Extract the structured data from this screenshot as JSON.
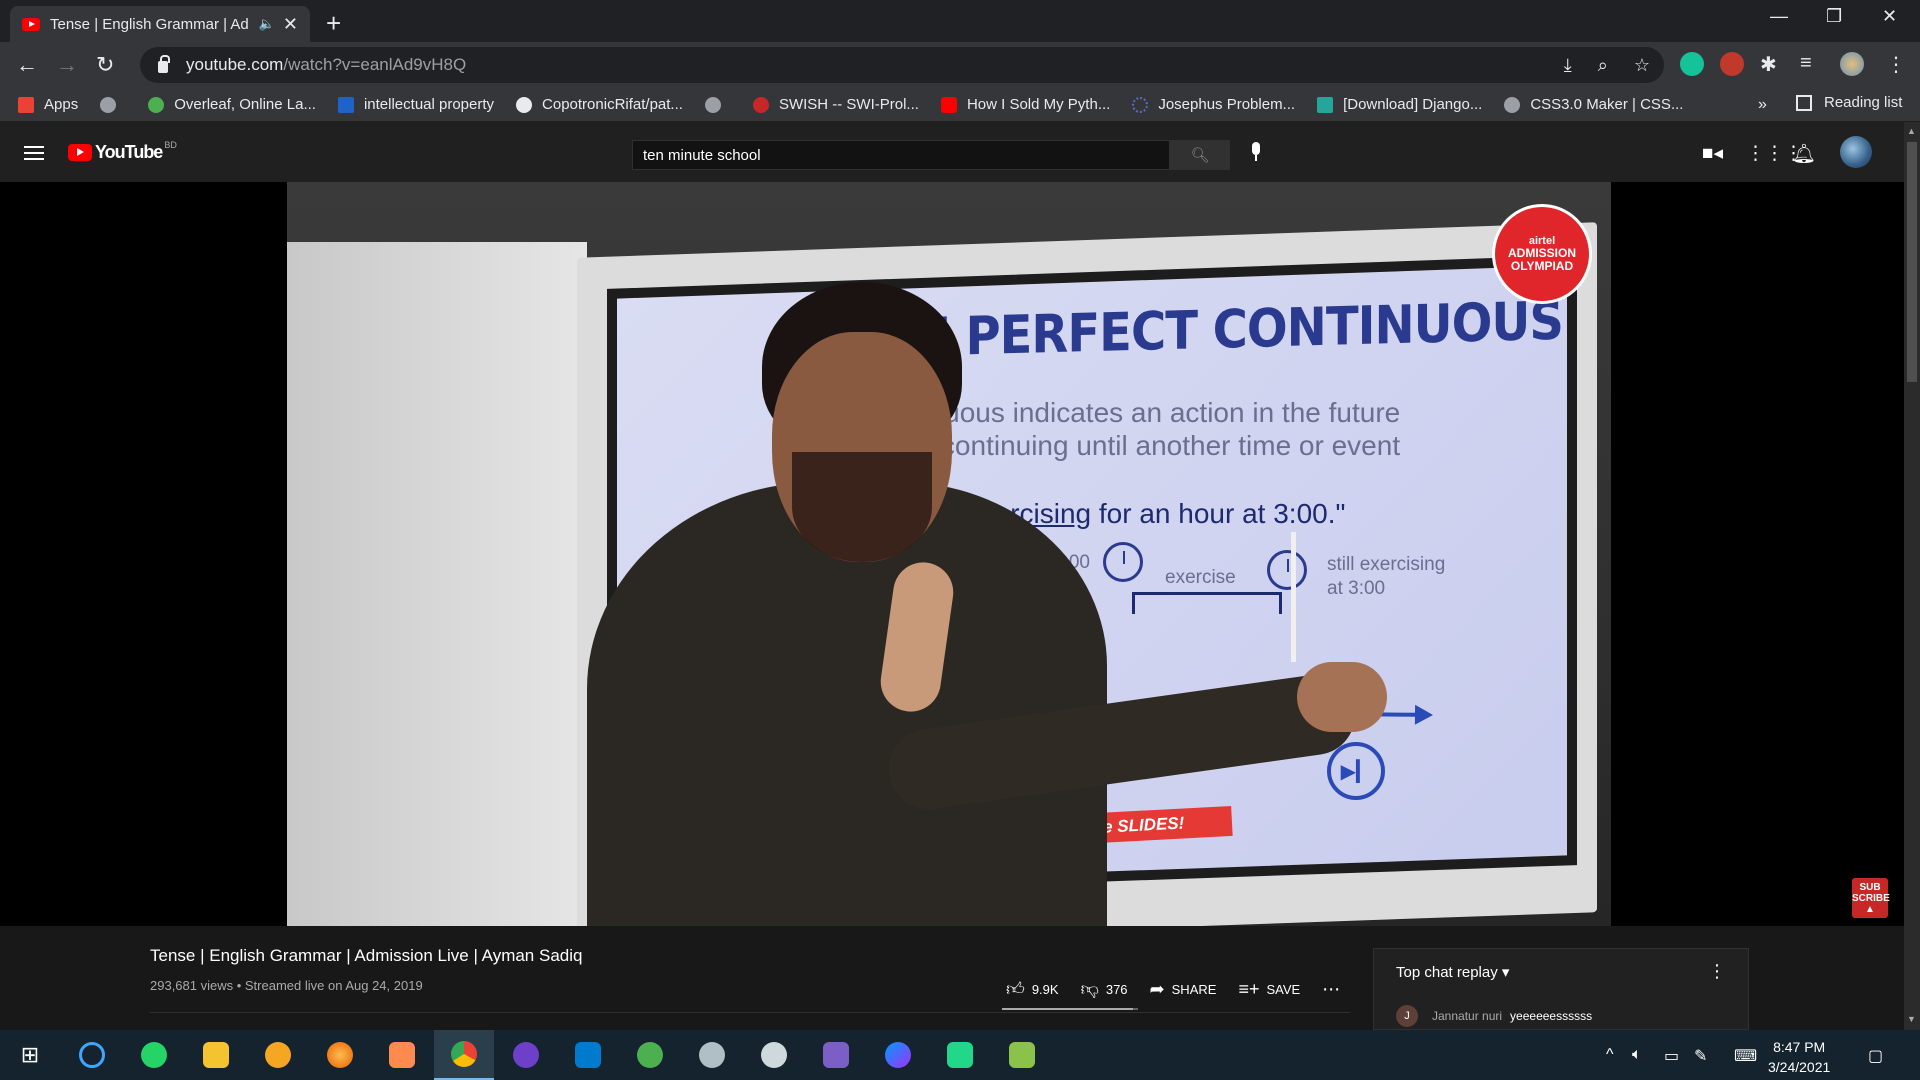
{
  "browser": {
    "tab_title": "Tense | English Grammar | Ad",
    "url_host": "youtube.com",
    "url_path": "/watch?v=eanlAd9vH8Q",
    "bookmarks": [
      {
        "label": "Apps",
        "color": "#ea4335"
      },
      {
        "label": "",
        "color": "#9aa0a6"
      },
      {
        "label": "Overleaf, Online La...",
        "color": "#4caf50"
      },
      {
        "label": "intellectual property",
        "color": "#1e64c8"
      },
      {
        "label": "CopotronicRifat/pat...",
        "color": "#e8eaed"
      },
      {
        "label": "",
        "color": "#9aa0a6"
      },
      {
        "label": "SWISH -- SWI-Prol...",
        "color": "#c62828"
      },
      {
        "label": "How I Sold My Pyth...",
        "color": "#ff0000"
      },
      {
        "label": "Josephus Problem...",
        "color": "#5c6bc0"
      },
      {
        "label": "[Download] Django...",
        "color": "#26a69a"
      },
      {
        "label": "CSS3.0 Maker | CSS...",
        "color": "#9aa0a6"
      }
    ],
    "more_label": "»",
    "reading_list": "Reading list"
  },
  "youtube": {
    "country_code": "BD",
    "search_value": "ten minute school",
    "video": {
      "slide_title": "RE PERFECT CONTINUOUS",
      "slide_line1": "ntinuous indicates an action in the future",
      "slide_line2": "en continuing until another time or event",
      "slide_sentence_underlined": "been exercising",
      "slide_sentence_rest": " for an hour at 3:00.\"",
      "time_start": "2:00",
      "exercise_label": "exercise",
      "still_label": "still exercising",
      "still_label2": "at 3:00",
      "banner": "the SLIDES!",
      "badge_top": "airtel",
      "badge_mid": "ADMISSION",
      "badge_bot": "OLYMPIAD",
      "subscribe_top": "SUB",
      "subscribe_bot": "SCRIBE"
    },
    "title": "Tense | English Grammar | Admission Live | Ayman Sadiq",
    "meta": "293,681 views • Streamed live on Aug 24, 2019",
    "likes": "9.9K",
    "dislikes": "376",
    "share": "SHARE",
    "save": "SAVE",
    "chat": {
      "header": "Top chat replay",
      "author": "Jannatur nuri",
      "author_initial": "J",
      "message": "yeeeeeessssss"
    }
  },
  "taskbar": {
    "time": "8:47 PM",
    "date": "3/24/2021"
  }
}
